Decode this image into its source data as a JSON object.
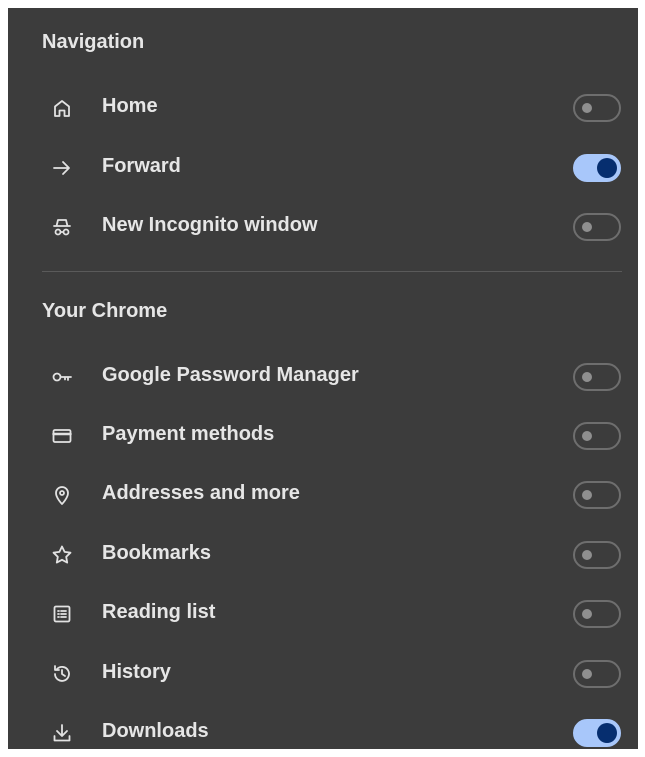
{
  "sections": [
    {
      "title": "Navigation",
      "items": [
        {
          "label": "Home",
          "icon": "home-icon",
          "enabled": false
        },
        {
          "label": "Forward",
          "icon": "forward-arrow-icon",
          "enabled": true
        },
        {
          "label": "New Incognito window",
          "icon": "incognito-icon",
          "enabled": false
        }
      ]
    },
    {
      "title": "Your Chrome",
      "items": [
        {
          "label": "Google Password Manager",
          "icon": "key-icon",
          "enabled": false
        },
        {
          "label": "Payment methods",
          "icon": "credit-card-icon",
          "enabled": false
        },
        {
          "label": "Addresses and more",
          "icon": "location-pin-icon",
          "enabled": false
        },
        {
          "label": "Bookmarks",
          "icon": "star-icon",
          "enabled": false
        },
        {
          "label": "Reading list",
          "icon": "reading-list-icon",
          "enabled": false
        },
        {
          "label": "History",
          "icon": "history-icon",
          "enabled": false
        },
        {
          "label": "Downloads",
          "icon": "download-icon",
          "enabled": true
        }
      ]
    }
  ],
  "colors": {
    "panel_background": "#3c3c3c",
    "text": "#e6e6e6",
    "toggle_on_track": "#a8c7fa",
    "toggle_on_knob": "#062e6f",
    "toggle_off_border": "#6e6e6e"
  }
}
